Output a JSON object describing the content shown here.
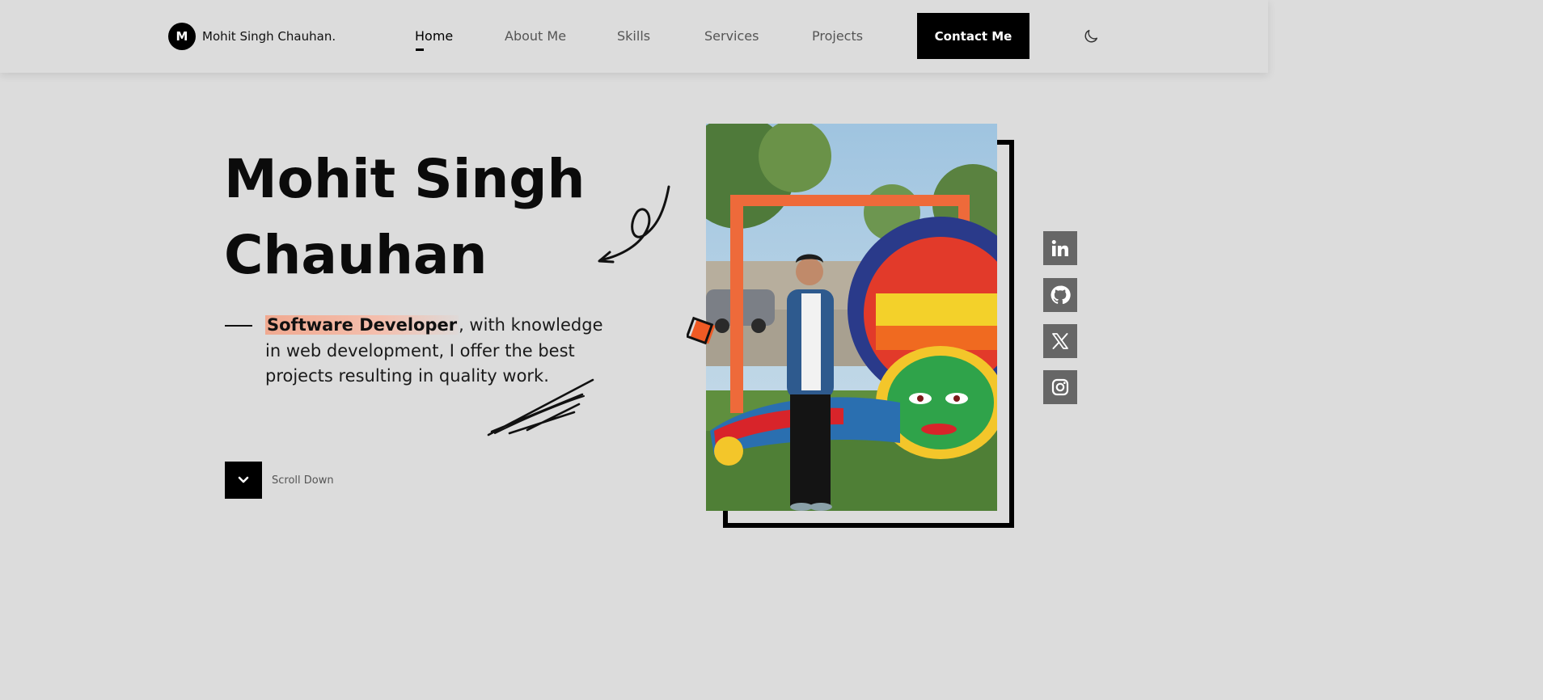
{
  "header": {
    "logo_letter": "M",
    "logo_text": "Mohit Singh Chauhan.",
    "nav": [
      {
        "label": "Home",
        "active": true
      },
      {
        "label": "About Me",
        "active": false
      },
      {
        "label": "Skills",
        "active": false
      },
      {
        "label": "Services",
        "active": false
      },
      {
        "label": "Projects",
        "active": false
      }
    ],
    "contact_label": "Contact Me",
    "theme_icon": "moon-icon"
  },
  "hero": {
    "title_line1": "Mohit Singh",
    "title_line2": "Chauhan",
    "highlight": "Software Developer",
    "description_rest": ", with knowledge in web development, I offer the best projects resulting in quality work.",
    "scroll_label": "Scroll Down"
  },
  "social": [
    {
      "icon": "linkedin-icon"
    },
    {
      "icon": "github-icon"
    },
    {
      "icon": "x-icon"
    },
    {
      "icon": "instagram-icon"
    }
  ],
  "colors": {
    "background": "#dcdcdc",
    "accent": "#000000",
    "highlight": "#f0a990",
    "social_bg": "#666666",
    "decor_orange": "#f05a24"
  }
}
